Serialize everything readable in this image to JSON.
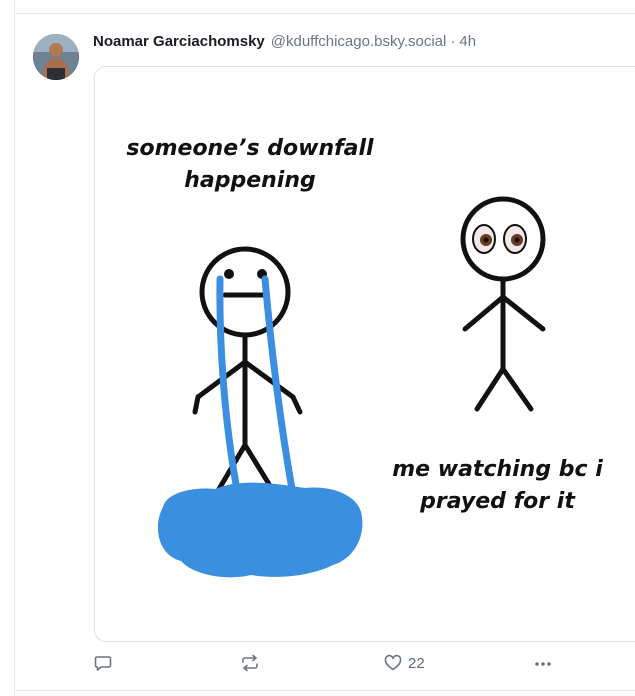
{
  "post": {
    "author_name": "Noamar Garciachomsky",
    "author_handle": "@kduffchicago.bsky.social",
    "separator": "·",
    "time": "4h",
    "media": {
      "caption_left_line1": "someone’s downfall",
      "caption_left_line2": "happening",
      "caption_right_line1": "me watching bc i",
      "caption_right_line2": "prayed for it"
    },
    "actions": {
      "reply_icon": "comment-bubble-icon",
      "repost_icon": "repost-arrows-icon",
      "like_icon": "heart-icon",
      "like_count": "22",
      "more_icon": "ellipsis-icon"
    }
  },
  "colors": {
    "text_primary": "#1a1d21",
    "text_secondary": "#6b7680",
    "tear_blue": "#3b8fe0",
    "border": "#dde1e6"
  }
}
